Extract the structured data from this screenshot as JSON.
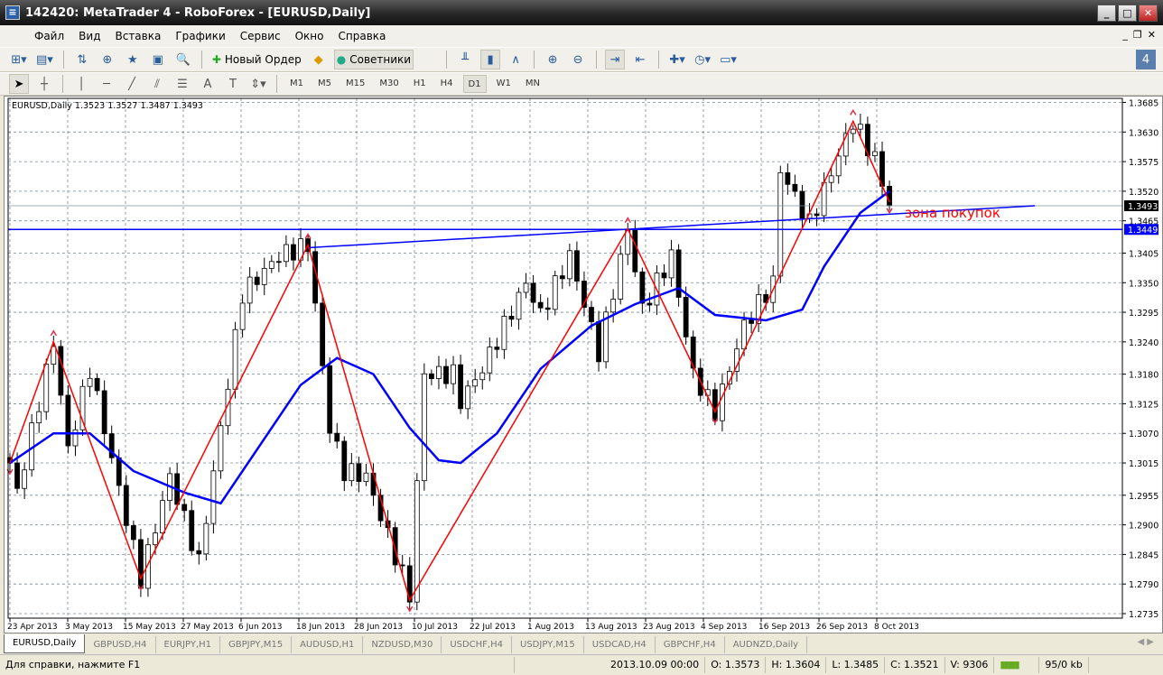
{
  "window": {
    "title": "142420: MetaTrader 4 - RoboForex - [EURUSD,Daily]"
  },
  "menu": [
    "Файл",
    "Вид",
    "Вставка",
    "Графики",
    "Сервис",
    "Окно",
    "Справка"
  ],
  "toolbar": {
    "new_order": "Новый Ордер",
    "experts": "Советники"
  },
  "drawing_tools": {
    "text_tool": "A"
  },
  "timeframes": [
    "M1",
    "M5",
    "M15",
    "M30",
    "H1",
    "H4",
    "D1",
    "W1",
    "MN"
  ],
  "active_timeframe": "D1",
  "chart": {
    "header": "EURUSD,Daily  1.3523 1.3527 1.3487 1.3493",
    "price_ticks": [
      "1.3685",
      "1.3630",
      "1.3575",
      "1.3520",
      "1.3465",
      "1.3405",
      "1.3350",
      "1.3295",
      "1.3240",
      "1.3180",
      "1.3125",
      "1.3070",
      "1.3015",
      "1.2955",
      "1.2900",
      "1.2845",
      "1.2790",
      "1.2735"
    ],
    "price_range": [
      1.2735,
      1.3685
    ],
    "bid_label": "1.3493",
    "level_label": "1.3449",
    "date_labels": [
      "23 Apr 2013",
      "3 May 2013",
      "15 May 2013",
      "27 May 2013",
      "6 Jun 2013",
      "18 Jun 2013",
      "28 Jun 2013",
      "10 Jul 2013",
      "22 Jul 2013",
      "1 Aug 2013",
      "13 Aug 2013",
      "23 Aug 2013",
      "4 Sep 2013",
      "16 Sep 2013",
      "26 Sep 2013",
      "8 Oct 2013"
    ],
    "annotation": "зона покупок",
    "bars": 122,
    "price_path": [
      [
        0,
        1.3015
      ],
      [
        1,
        1.296
      ],
      [
        6,
        1.324
      ],
      [
        8,
        1.304
      ],
      [
        11,
        1.319
      ],
      [
        18,
        1.28
      ],
      [
        22,
        1.299
      ],
      [
        26,
        1.283
      ],
      [
        32,
        1.333
      ],
      [
        37,
        1.34
      ],
      [
        41,
        1.342
      ],
      [
        44,
        1.308
      ],
      [
        46,
        1.3
      ],
      [
        49,
        1.299
      ],
      [
        55,
        1.277
      ],
      [
        57,
        1.318
      ],
      [
        61,
        1.318
      ],
      [
        62,
        1.313
      ],
      [
        65,
        1.319
      ],
      [
        71,
        1.335
      ],
      [
        73,
        1.329
      ],
      [
        77,
        1.34
      ],
      [
        81,
        1.322
      ],
      [
        85,
        1.345
      ],
      [
        87,
        1.33
      ],
      [
        91,
        1.34
      ],
      [
        94,
        1.318
      ],
      [
        97,
        1.311
      ],
      [
        101,
        1.327
      ],
      [
        105,
        1.335
      ],
      [
        106,
        1.356
      ],
      [
        110,
        1.346
      ],
      [
        116,
        1.365
      ],
      [
        119,
        1.358
      ],
      [
        121,
        1.3493
      ]
    ],
    "zigzag": [
      [
        0,
        1.3015
      ],
      [
        6,
        1.324
      ],
      [
        18,
        1.28
      ],
      [
        41,
        1.342
      ],
      [
        55,
        1.276
      ],
      [
        85,
        1.345
      ],
      [
        97,
        1.311
      ],
      [
        116,
        1.365
      ],
      [
        121,
        1.35
      ]
    ],
    "moving_average": [
      [
        0,
        1.3015
      ],
      [
        6,
        1.307
      ],
      [
        11,
        1.307
      ],
      [
        17,
        1.3
      ],
      [
        24,
        1.296
      ],
      [
        29,
        1.294
      ],
      [
        35,
        1.306
      ],
      [
        40,
        1.316
      ],
      [
        45,
        1.321
      ],
      [
        50,
        1.318
      ],
      [
        55,
        1.308
      ],
      [
        59,
        1.302
      ],
      [
        62,
        1.3015
      ],
      [
        67,
        1.307
      ],
      [
        73,
        1.319
      ],
      [
        80,
        1.327
      ],
      [
        86,
        1.331
      ],
      [
        92,
        1.334
      ],
      [
        97,
        1.329
      ],
      [
        104,
        1.328
      ],
      [
        109,
        1.33
      ],
      [
        112,
        1.338
      ],
      [
        117,
        1.348
      ],
      [
        121,
        1.352
      ]
    ],
    "trendline": [
      [
        41,
        1.3415
      ],
      [
        141,
        1.3493
      ]
    ],
    "horizontal_level": 1.3449,
    "colors": {
      "zigzag": "#ff0000",
      "ma": "#0000ff",
      "level": "#0000ff",
      "grid": "#7a8a9a",
      "annotation": "#ff0000"
    }
  },
  "tabs": [
    "EURUSD,Daily",
    "GBPUSD,H4",
    "EURJPY,H1",
    "GBPJPY,M15",
    "AUDUSD,H1",
    "NZDUSD,M30",
    "USDCHF,H4",
    "USDJPY,M15",
    "USDCAD,H4",
    "GBPCHF,H4",
    "AUDNZD,Daily"
  ],
  "status": {
    "help": "Для справки, нажмите F1",
    "datetime": "2013.10.09 00:00",
    "open": "O: 1.3573",
    "high": "H: 1.3604",
    "low": "L: 1.3485",
    "close": "C: 1.3521",
    "volume": "V: 9306",
    "traffic": "95/0 kb"
  }
}
